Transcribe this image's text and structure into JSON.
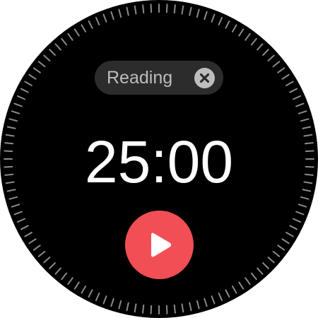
{
  "timer": {
    "label": "Reading",
    "time": "25:00"
  },
  "icons": {
    "close": "close-icon",
    "play": "play-icon"
  },
  "colors": {
    "background": "#000000",
    "chip": "#2c2c2c",
    "chip_text": "#bdbdbd",
    "time_text": "#ffffff",
    "accent": "#f24e55",
    "ticks": "#8a8a8a"
  }
}
